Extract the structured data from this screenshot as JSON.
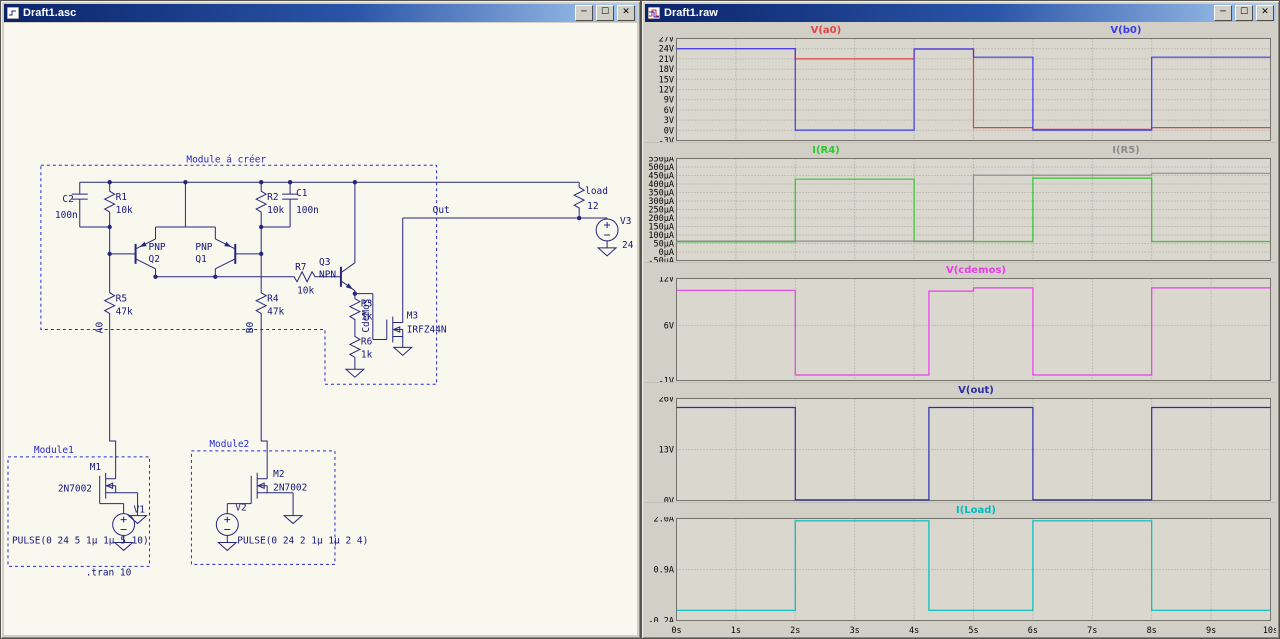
{
  "chrome": {
    "minimize": "─",
    "maximize": "☐",
    "close": "✕"
  },
  "left_window": {
    "title": "Draft1.asc",
    "schematic": {
      "module_main": "Module á créer",
      "module1": "Module1",
      "module2": "Module2",
      "directive_tran": ".tran 10",
      "labels": {
        "c2": "C2",
        "c2_val": "100n",
        "r1": "R1",
        "r1_val": "10k",
        "r2": "R2",
        "r2_val": "10k",
        "c1": "C1",
        "c1_val": "100n",
        "q2_type": "PNP",
        "q2": "Q2",
        "q1_type": "PNP",
        "q1": "Q1",
        "r7": "R7",
        "r7_val": "10k",
        "q3": "Q3",
        "q3_type": "NPN",
        "r5": "R5",
        "r5_val": "47k",
        "net_a0": "A0",
        "r4": "R4",
        "r4_val": "47k",
        "net_b0": "B0",
        "r3": "R3",
        "r3_val": "1k",
        "net_cdemos": "CdeMos",
        "m3": "M3",
        "m3_val": "IRFZ44N",
        "r6": "R6",
        "r6_val": "1k",
        "net_out": "Out",
        "load": "load",
        "load_val": "12",
        "v3": "V3",
        "v3_val": "24",
        "m1": "M1",
        "m1_val": "2N7002",
        "v1": "V1",
        "pulse1": "PULSE(0 24 5 1µ 1µ 5 10)",
        "m2": "M2",
        "m2_val": "2N7002",
        "v2": "V2",
        "pulse2": "PULSE(0 24 2 1µ 1µ 2 4)"
      }
    }
  },
  "right_window": {
    "title": "Draft1.raw",
    "xticks": [
      {
        "v": 0,
        "label": "0s"
      },
      {
        "v": 1,
        "label": "1s"
      },
      {
        "v": 2,
        "label": "2s"
      },
      {
        "v": 3,
        "label": "3s"
      },
      {
        "v": 4,
        "label": "4s"
      },
      {
        "v": 5,
        "label": "5s"
      },
      {
        "v": 6,
        "label": "6s"
      },
      {
        "v": 7,
        "label": "7s"
      },
      {
        "v": 8,
        "label": "8s"
      },
      {
        "v": 9,
        "label": "9s"
      },
      {
        "v": 10,
        "label": "10s"
      }
    ]
  },
  "chart_data": [
    {
      "type": "step-line",
      "xlim": [
        0,
        10
      ],
      "ylim": [
        -3,
        27
      ],
      "grid": true,
      "yticks": [
        {
          "v": 27,
          "label": "27V"
        },
        {
          "v": 24,
          "label": "24V"
        },
        {
          "v": 21,
          "label": "21V"
        },
        {
          "v": 18,
          "label": "18V"
        },
        {
          "v": 15,
          "label": "15V"
        },
        {
          "v": 12,
          "label": "12V"
        },
        {
          "v": 9,
          "label": "9V"
        },
        {
          "v": 6,
          "label": "6V"
        },
        {
          "v": 3,
          "label": "3V"
        },
        {
          "v": 0,
          "label": "0V"
        },
        {
          "v": -3,
          "label": "-3V"
        }
      ],
      "series": [
        {
          "name": "V(a0)",
          "color": "#e04545",
          "points": [
            [
              0,
              24
            ],
            [
              2,
              24
            ],
            [
              2,
              21
            ],
            [
              4,
              21
            ],
            [
              4,
              23.9
            ],
            [
              5,
              23.9
            ],
            [
              5,
              0.8
            ],
            [
              6,
              0.8
            ],
            [
              6,
              0.3
            ],
            [
              8,
              0.3
            ],
            [
              8,
              0.8
            ],
            [
              10,
              0.8
            ]
          ]
        },
        {
          "name": "V(b0)",
          "color": "#3a3af2",
          "points": [
            [
              0,
              24
            ],
            [
              2,
              24
            ],
            [
              2,
              0.05
            ],
            [
              4,
              0.05
            ],
            [
              4,
              23.9
            ],
            [
              5,
              23.9
            ],
            [
              5,
              21.5
            ],
            [
              6,
              21.5
            ],
            [
              6,
              0.05
            ],
            [
              8,
              0.05
            ],
            [
              8,
              21.5
            ],
            [
              10,
              21.5
            ]
          ]
        }
      ]
    },
    {
      "type": "step-line",
      "xlim": [
        0,
        10
      ],
      "ylim": [
        -50,
        550
      ],
      "grid": true,
      "yticks": [
        {
          "v": 550,
          "label": "550µA"
        },
        {
          "v": 500,
          "label": "500µA"
        },
        {
          "v": 450,
          "label": "450µA"
        },
        {
          "v": 400,
          "label": "400µA"
        },
        {
          "v": 350,
          "label": "350µA"
        },
        {
          "v": 300,
          "label": "300µA"
        },
        {
          "v": 250,
          "label": "250µA"
        },
        {
          "v": 200,
          "label": "200µA"
        },
        {
          "v": 150,
          "label": "150µA"
        },
        {
          "v": 100,
          "label": "100µA"
        },
        {
          "v": 50,
          "label": "50µA"
        },
        {
          "v": 0,
          "label": "0µA"
        },
        {
          "v": -50,
          "label": "-50µA"
        }
      ],
      "series": [
        {
          "name": "I(R4)",
          "color": "#2fc82f",
          "points": [
            [
              0,
              60
            ],
            [
              2,
              60
            ],
            [
              2,
              428
            ],
            [
              4,
              428
            ],
            [
              4,
              62
            ],
            [
              6,
              62
            ],
            [
              6,
              435
            ],
            [
              8,
              435
            ],
            [
              8,
              62
            ],
            [
              10,
              62
            ]
          ]
        },
        {
          "name": "I(R5)",
          "color": "#8c8c8c",
          "points": [
            [
              0,
              64
            ],
            [
              5,
              64
            ],
            [
              5,
              452
            ],
            [
              8,
              452
            ],
            [
              8,
              463
            ],
            [
              10,
              463
            ]
          ]
        }
      ]
    },
    {
      "type": "step-line",
      "xlim": [
        0,
        10
      ],
      "ylim": [
        -1,
        12
      ],
      "grid": true,
      "yticks": [
        {
          "v": 12,
          "label": "12V"
        },
        {
          "v": 6,
          "label": "6V"
        },
        {
          "v": -1,
          "label": "-1V"
        }
      ],
      "series": [
        {
          "name": "V(cdemos)",
          "color": "#ea3cea",
          "points": [
            [
              0,
              10.5
            ],
            [
              2,
              10.5
            ],
            [
              2,
              -0.3
            ],
            [
              4.25,
              -0.3
            ],
            [
              4.25,
              10.4
            ],
            [
              5,
              10.4
            ],
            [
              5,
              10.8
            ],
            [
              6,
              10.8
            ],
            [
              6,
              -0.3
            ],
            [
              8,
              -0.3
            ],
            [
              8,
              10.8
            ],
            [
              10,
              10.8
            ]
          ]
        }
      ]
    },
    {
      "type": "step-line",
      "xlim": [
        0,
        10
      ],
      "ylim": [
        0,
        26
      ],
      "grid": true,
      "yticks": [
        {
          "v": 26,
          "label": "26V"
        },
        {
          "v": 13,
          "label": "13V"
        },
        {
          "v": 0,
          "label": "0V"
        }
      ],
      "series": [
        {
          "name": "V(out)",
          "color": "#2d2da8",
          "points": [
            [
              0,
              23.7
            ],
            [
              2,
              23.7
            ],
            [
              2,
              0.15
            ],
            [
              4.25,
              0.15
            ],
            [
              4.25,
              23.7
            ],
            [
              6,
              23.7
            ],
            [
              6,
              0.15
            ],
            [
              8,
              0.15
            ],
            [
              8,
              23.7
            ],
            [
              10,
              23.7
            ]
          ]
        }
      ]
    },
    {
      "type": "step-line",
      "xlim": [
        0,
        10
      ],
      "ylim": [
        -0.2,
        2.0
      ],
      "grid": true,
      "yticks": [
        {
          "v": 2.0,
          "label": "2.0A"
        },
        {
          "v": 0.9,
          "label": "0.9A"
        },
        {
          "v": -0.2,
          "label": "-0.2A"
        }
      ],
      "series": [
        {
          "name": "I(Load)",
          "color": "#00bcbc",
          "points": [
            [
              0,
              0.02
            ],
            [
              2,
              0.02
            ],
            [
              2,
              1.95
            ],
            [
              4.25,
              1.95
            ],
            [
              4.25,
              0.02
            ],
            [
              6,
              0.02
            ],
            [
              6,
              1.95
            ],
            [
              8,
              1.95
            ],
            [
              8,
              0.02
            ],
            [
              10,
              0.02
            ]
          ]
        }
      ]
    }
  ]
}
